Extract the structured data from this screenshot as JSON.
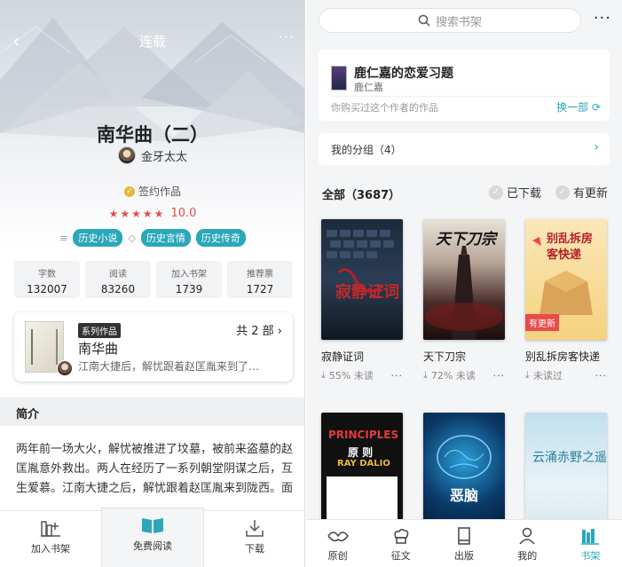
{
  "left": {
    "header": {
      "title": "连载",
      "back_icon": "chevron-left-icon",
      "more_icon": "more-icon"
    },
    "book": {
      "title": "南华曲（二）",
      "author": "金牙太太",
      "signed_label": "签约作品",
      "rating": "10.0",
      "stars": 5,
      "tags": [
        "历史小说",
        "历史言情",
        "历史传奇"
      ]
    },
    "stats": [
      {
        "label": "字数",
        "value": "132007"
      },
      {
        "label": "阅读",
        "value": "83260"
      },
      {
        "label": "加入书架",
        "value": "1739"
      },
      {
        "label": "推荐票",
        "value": "1727"
      }
    ],
    "series": {
      "badge": "系列作品",
      "count": "共 2 部",
      "title": "南华曲",
      "desc": "江南大捷后，解忧跟着赵匡胤来到了…"
    },
    "intro": {
      "heading": "简介",
      "text": "两年前一场大火，解忧被推进了坟墓，被前来盗墓的赵匡胤意外救出。两人在经历了一系列朝堂阴谋之后，互生爱慕。江南大捷之后，解忧跟着赵匡胤来到陇西。面"
    },
    "bottom": {
      "add_shelf": "加入书架",
      "free_read": "免费阅读",
      "download": "下载"
    }
  },
  "right": {
    "search_placeholder": "搜索书架",
    "recommend": {
      "title": "鹿仁嘉的恋爱习题",
      "author": "鹿仁嘉",
      "note": "你购买过这个作者的作品",
      "swap": "换一部"
    },
    "groups_label": "我的分组（4）",
    "all_label": "全部（3687）",
    "downloaded_label": "已下载",
    "updated_label": "有更新",
    "books": [
      {
        "title": "寂静证词",
        "meta": "55% 未读",
        "cover_text": "寂静证词"
      },
      {
        "title": "天下刀宗",
        "meta": "72% 未读",
        "cover_text": "天下刀宗"
      },
      {
        "title": "别乱拆房客快递",
        "meta": "未读过",
        "cover_text": "别乱拆房客快递",
        "badge": "有更新"
      },
      {
        "title": "",
        "meta": "",
        "cover_text_1": "PRINCIPLES",
        "cover_text_2": "原 则",
        "cover_text_3": "RAY DALIO"
      },
      {
        "title": "",
        "meta": "",
        "cover_text": "恶脑"
      },
      {
        "title": "",
        "meta": "",
        "cover_text": "云涌赤野之遥"
      }
    ],
    "tabs": [
      "原创",
      "征文",
      "出版",
      "我的",
      "书架"
    ],
    "accent": "#2aa7b8"
  }
}
